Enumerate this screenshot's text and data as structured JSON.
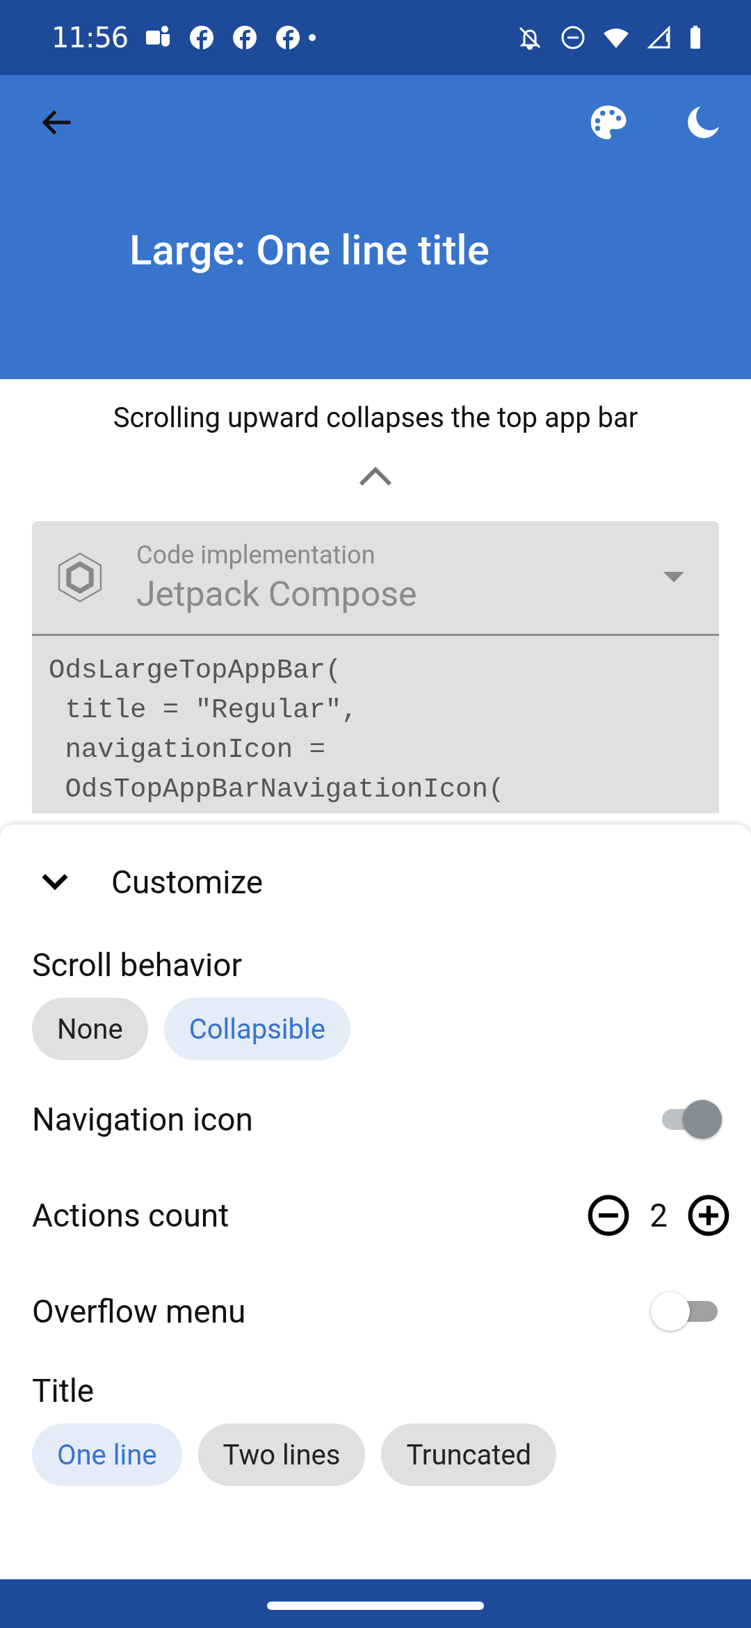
{
  "status_bar": {
    "time": "11:56"
  },
  "app_bar": {
    "title": "Large: One line title"
  },
  "hint": "Scrolling upward collapses the top app bar",
  "code_card": {
    "label": "Code implementation",
    "value": "Jetpack Compose",
    "lines": [
      "OdsLargeTopAppBar(",
      " title = \"Regular\",",
      " navigationIcon =",
      " OdsTopAppBarNavigationIcon("
    ]
  },
  "customize": {
    "title": "Customize",
    "expanded": true,
    "sections": [
      {
        "kind": "chips",
        "label": "Scroll behavior",
        "chips": [
          {
            "label": "None",
            "selected": false
          },
          {
            "label": "Collapsible",
            "selected": true
          }
        ]
      },
      {
        "kind": "switch",
        "label": "Navigation icon",
        "on": true
      },
      {
        "kind": "counter",
        "label": "Actions count",
        "value": "2"
      },
      {
        "kind": "switch",
        "label": "Overflow menu",
        "on": false
      },
      {
        "kind": "chips",
        "label": "Title",
        "chips": [
          {
            "label": "One line",
            "selected": true
          },
          {
            "label": "Two lines",
            "selected": false
          },
          {
            "label": "Truncated",
            "selected": false
          }
        ]
      }
    ]
  }
}
